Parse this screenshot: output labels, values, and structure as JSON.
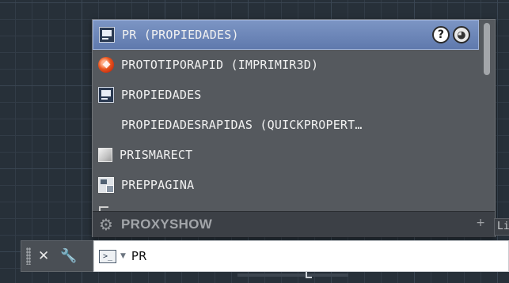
{
  "popup": {
    "items": [
      {
        "label": "PR (PROPIEDADES)",
        "icon": "properties-icon"
      },
      {
        "label": "PROTOTIPORAPID (IMPRIMIR3D)",
        "icon": "3d-print-icon"
      },
      {
        "label": "PROPIEDADES",
        "icon": "properties-icon"
      },
      {
        "label": "PROPIEDADESRAPIDAS (QUICKPROPERT…",
        "icon": ""
      },
      {
        "label": "PRISMARECT",
        "icon": "box-icon"
      },
      {
        "label": "PREPPAGINA",
        "icon": "page-setup-icon"
      }
    ],
    "selected_index": 0,
    "category": {
      "label": "PROXYSHOW",
      "icon": "gear-icon",
      "expand": "+"
    }
  },
  "command_line": {
    "input_value": "PR",
    "prompt_icon": "command-prompt-icon",
    "prompt_glyph": ">_"
  },
  "edge_tab": {
    "text": "Li"
  },
  "colors": {
    "selection": "#6f88b9",
    "popup_bg": "#55595e",
    "canvas_bg": "#273039"
  }
}
